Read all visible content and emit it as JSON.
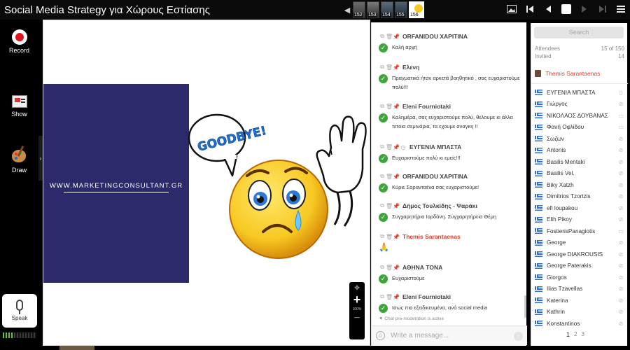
{
  "title": "Social Media Strategy για Χώρους Εστίασης",
  "slides": {
    "thumbs": [
      {
        "num": "152"
      },
      {
        "num": "153"
      },
      {
        "num": "154"
      },
      {
        "num": "155"
      },
      {
        "num": "156"
      }
    ]
  },
  "left_rail": {
    "record": "Record",
    "show": "Show",
    "draw": "Draw",
    "speak": "Speak"
  },
  "slide": {
    "url": "WWW.MARKETINGCONSULTANT.GR",
    "goodbye": "GOODBYE!",
    "zoom_pct": "100%"
  },
  "chat": {
    "messages": [
      {
        "author": "ORFANIDOU ΧΑΡΙΤΙΝΑ",
        "text": "Καλή αρχή",
        "host": false
      },
      {
        "author": "Ελενη",
        "text": "Πραγματικά ήταν αρκετά βοηθητικό , σας ευχαριστούμε πολύ!!!",
        "host": false
      },
      {
        "author": "Eleni Fourniotaki",
        "text": "Καλημέρα, σας ευχαριστούμε πολύ, θελουμε κι άλλα τετοια σεμινάρια, τα εχουμε αναγκη !!",
        "host": false
      },
      {
        "author": "ΕΥΓΕΝΙΑ ΜΠΑΣΤΑ",
        "text": "Ευχαριστούμε πολύ κι εμείς!!!",
        "host": false
      },
      {
        "author": "ORFANIDOU ΧΑΡΙΤΙΝΑ",
        "text": "Κύριε Σαρανταένα σας ευχαριστούμε!",
        "host": false
      },
      {
        "author": "Δήμος Τουλκίδης - Ψαράκι",
        "text": "Συγχαρητήρια Ιορδάνη. Συγχαρητήρεια Θέμη",
        "host": false
      },
      {
        "author": "Themis Sarantaenas",
        "text": "🙏",
        "host": true
      },
      {
        "author": "ΑΘΗΝΑ ΤΟΝΑ",
        "text": "Ευχαριστούμε",
        "host": false
      },
      {
        "author": "Eleni Fourniotaki",
        "text": "Ισως πιο εξειδικευμένα, ανά social media",
        "host": false
      }
    ],
    "premod": "Chat pre-moderation is active",
    "placeholder": "Write a message..."
  },
  "people": {
    "search": "Search",
    "attendees_label": "Attendees",
    "attendees_value": "15 of 150",
    "invited_label": "Invited",
    "invited_value": "14",
    "host": "Themis Sarantaenas",
    "list": [
      {
        "name": "ΕΥΓΕΝΙΑ ΜΠΑΣΤΑ",
        "device": "phone"
      },
      {
        "name": "Γιώργος",
        "device": "off"
      },
      {
        "name": "ΝΙΚΟΛΑΟΣ ΔΟΥΒΑΝΑΣ",
        "device": "desktop"
      },
      {
        "name": "Φανή Οφλίδου",
        "device": "desktop"
      },
      {
        "name": "Σωζων",
        "device": "off"
      },
      {
        "name": "Antonis",
        "device": "off"
      },
      {
        "name": "Basilis Mentaki",
        "device": "off"
      },
      {
        "name": "Basilis Vel.",
        "device": "off"
      },
      {
        "name": "Biky Xatzh",
        "device": "off"
      },
      {
        "name": "Dimitrios Tzortzis",
        "device": "off"
      },
      {
        "name": "efi loupakou",
        "device": "off"
      },
      {
        "name": "Elih Pikoy",
        "device": "off"
      },
      {
        "name": "FostierisPanagiotis",
        "device": "desktop"
      },
      {
        "name": "George",
        "device": "off"
      },
      {
        "name": "George DIAKROUSIS",
        "device": "off"
      },
      {
        "name": "George Paterakis",
        "device": "off"
      },
      {
        "name": "Giorgos",
        "device": "off"
      },
      {
        "name": "Ilias Tzavellas",
        "device": "off"
      },
      {
        "name": "Katerina",
        "device": "off"
      },
      {
        "name": "Kathrin",
        "device": "off"
      },
      {
        "name": "Konstantinos",
        "device": "off"
      }
    ],
    "pages": [
      "1",
      "2",
      "3"
    ]
  },
  "colors": {
    "host_red": "#e23b2a",
    "check_green": "#3ea53a",
    "slide_navy": "#2d2a6b",
    "emoji_yellow": "#f7c822"
  }
}
